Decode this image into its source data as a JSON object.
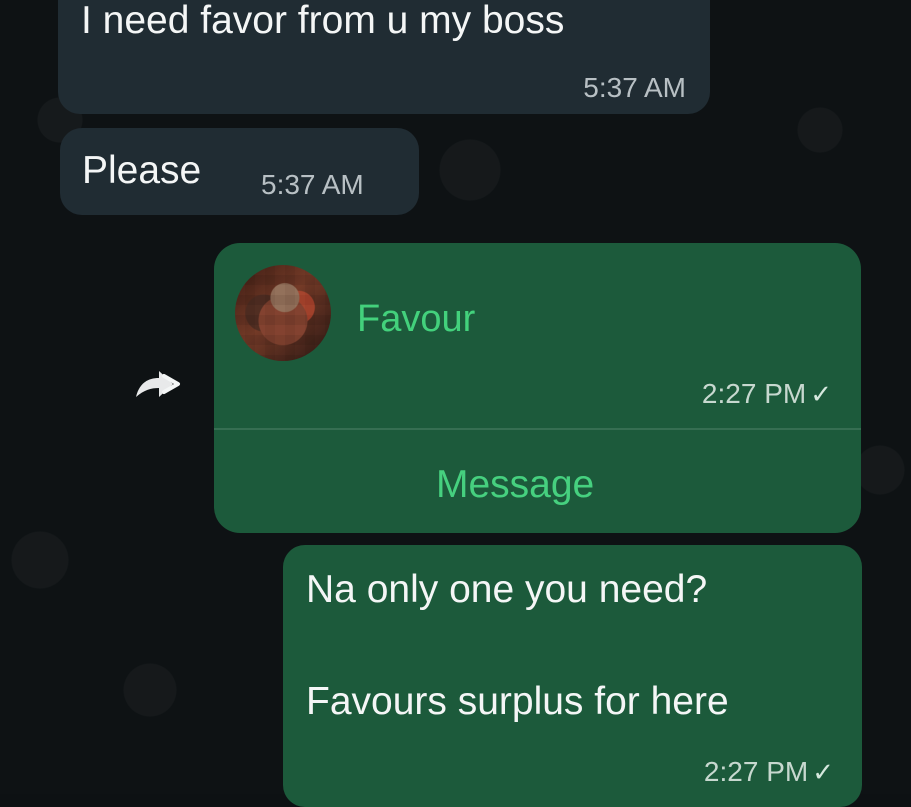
{
  "messages": {
    "incoming": [
      {
        "text": "I need favor from u my boss",
        "time": "5:37 AM"
      },
      {
        "text": "Please",
        "time": "5:37 AM"
      }
    ],
    "contact_card": {
      "contact_name": "Favour",
      "time": "2:27 PM",
      "status_tick": "✓",
      "action_label": "Message"
    },
    "reply": {
      "line1": "Na only one you need?",
      "line2": "Favours surplus for here",
      "time": "2:27 PM",
      "status_tick": "✓"
    }
  },
  "icons": {
    "forward": "forward-icon",
    "avatar": "avatar"
  },
  "colors": {
    "background": "#0e1214",
    "incoming_bubble": "#202c33",
    "outgoing_bubble": "#1c5a3b",
    "contact_accent": "#43d17c"
  }
}
